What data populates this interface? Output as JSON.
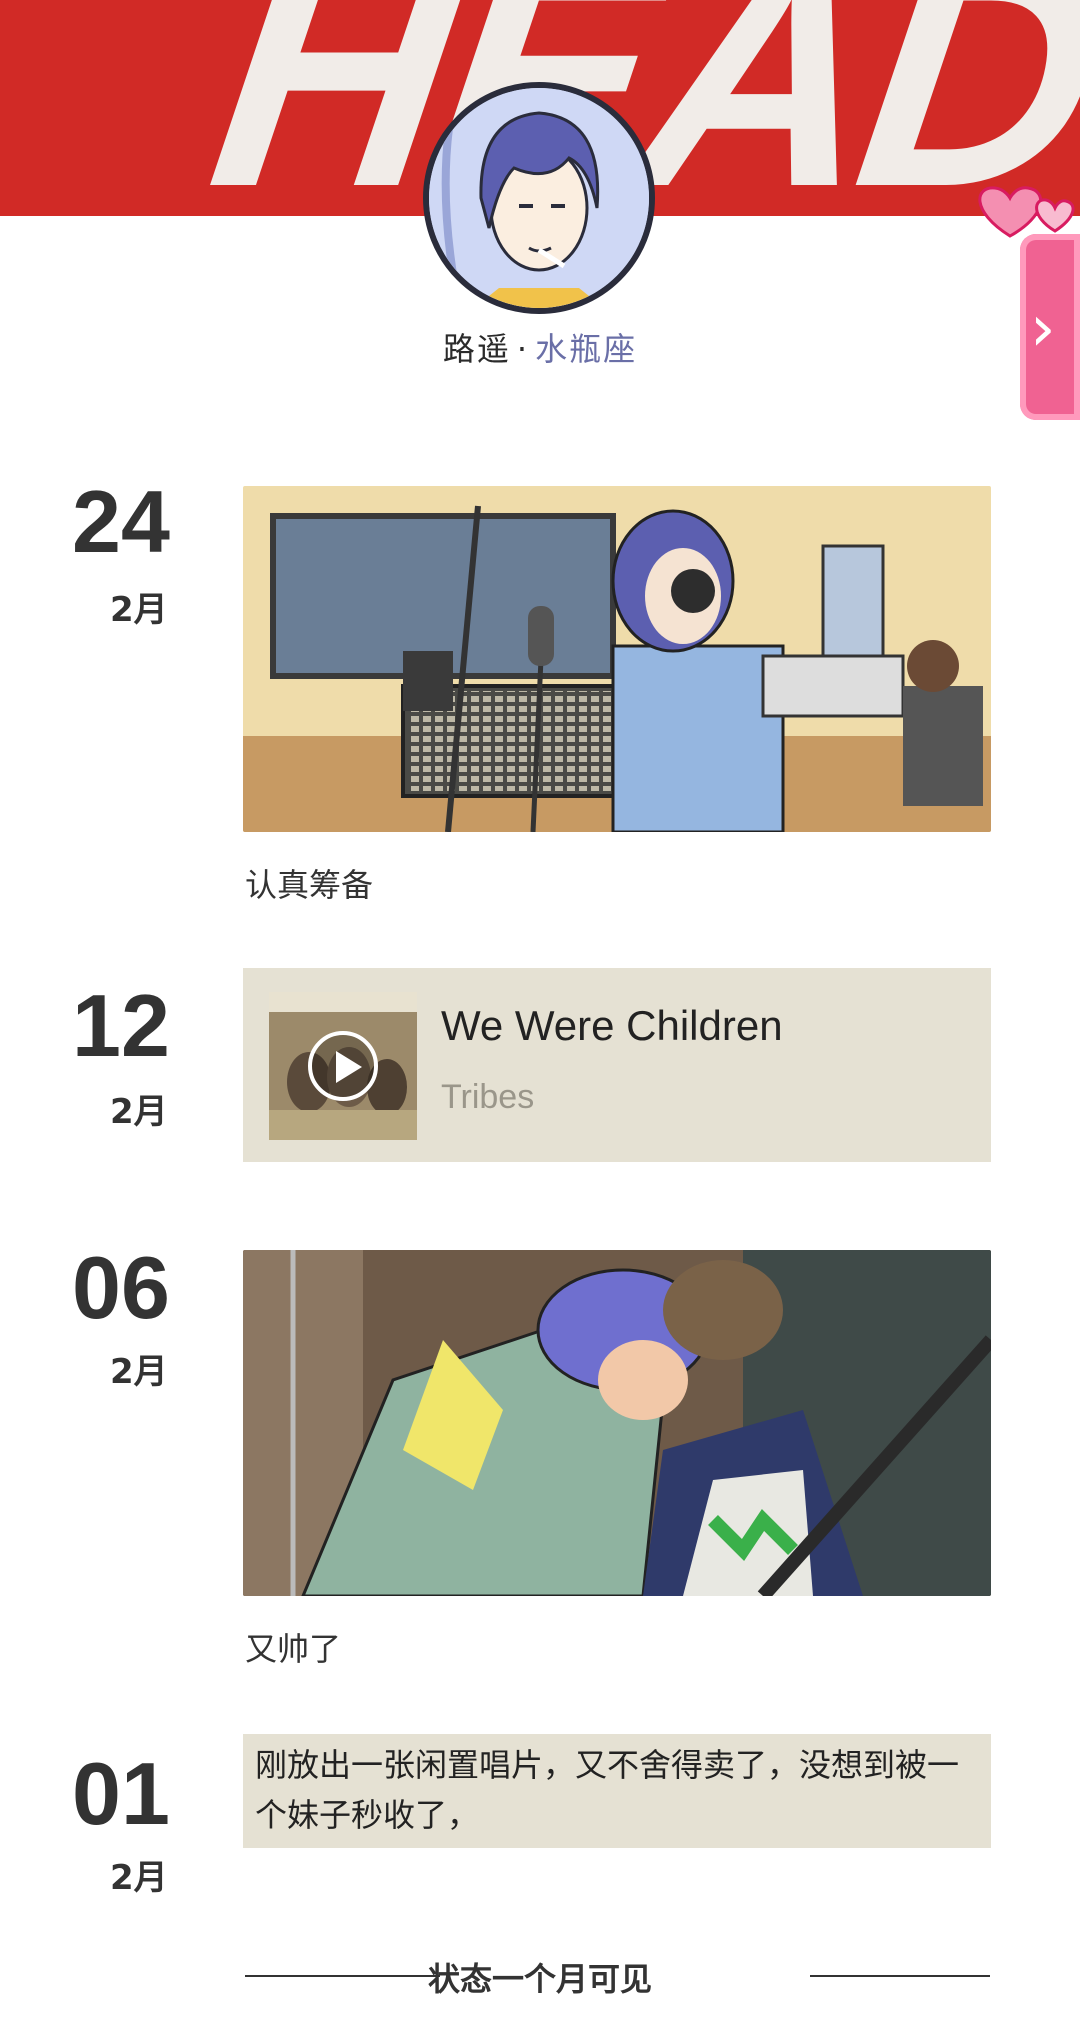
{
  "header": {
    "banner_text": "HEADS",
    "profile": {
      "name": "路遥",
      "separator": "·",
      "sign": "水瓶座"
    }
  },
  "side_tab": {
    "arrow": "›"
  },
  "timeline": [
    {
      "day": "24",
      "month": "2月",
      "type": "image",
      "caption": "认真筹备"
    },
    {
      "day": "12",
      "month": "2月",
      "type": "music",
      "music": {
        "title": "We Were Children",
        "artist": "Tribes"
      }
    },
    {
      "day": "06",
      "month": "2月",
      "type": "image",
      "caption": "又帅了"
    },
    {
      "day": "01",
      "month": "2月",
      "type": "text",
      "text": "刚放出一张闲置唱片，又不舍得卖了，没想到被一个妹子秒收了，"
    }
  ],
  "footer": {
    "label": "状态一个月可见"
  },
  "colors": {
    "banner": "#d12a26",
    "card_bg": "#e5e1d3",
    "pink_tab": "#f06292"
  }
}
